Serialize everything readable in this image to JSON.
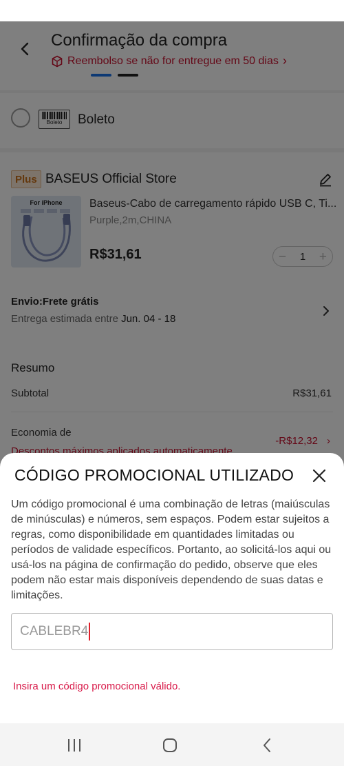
{
  "header": {
    "title": "Confirmação da compra",
    "refund_notice": "Reembolso se não for entregue em 50 dias",
    "refund_chevron": "›"
  },
  "payment": {
    "method_label": "Boleto",
    "logo_text": "Boleto"
  },
  "store": {
    "badge": "Plus",
    "name": "BASEUS Official Store",
    "product": {
      "image_label": "For iPhone",
      "name": "Baseus-Cabo de carregamento rápido USB C, Ti...",
      "variant": "Purple,2m,CHINA",
      "price": "R$31,61",
      "quantity": "1",
      "minus": "−",
      "plus": "+"
    },
    "shipping": {
      "title": "Envio:Frete grátis",
      "eta_prefix": "Entrega estimada entre ",
      "eta_dates": "Jun. 04 - 18"
    }
  },
  "summary": {
    "title": "Resumo",
    "subtotal_label": "Subtotal",
    "subtotal_value": "R$31,61",
    "savings_label": "Economia de",
    "savings_value": "-R$12,32",
    "savings_chevron": "›",
    "auto_discount": "Descontos máximos aplicados automaticamente"
  },
  "promo_sheet": {
    "title": "CÓDIGO PROMOCIONAL UTILIZADO",
    "close_symbol": "✕",
    "description": "Um código promocional é uma combinação de letras (maiúsculas de minúsculas) e números, sem espaços. Podem estar sujeitos a regras, como disponibilidade em quantidades limitadas ou períodos de validade específicos. Portanto, ao solicitá-los aqui ou usá-los na página de confirmação do pedido, observe que eles podem não estar mais disponíveis dependendo de suas datas e limitações.",
    "input_value": "CABLEBR4",
    "error": "Insira um código promocional válido."
  },
  "icons": {
    "back": "chevron-left-icon",
    "refund": "hexagon-box-icon",
    "edit": "pencil-icon",
    "shipping_chevron": "chevron-right-icon",
    "close": "close-icon",
    "nav_recents": "recents-icon",
    "nav_home": "home-icon",
    "nav_back": "back-icon"
  },
  "colors": {
    "accent_red": "#c8102e",
    "error_pink": "#d81b4a",
    "plus_badge_text": "#c8701a",
    "tab_blue": "#1a73e8"
  }
}
